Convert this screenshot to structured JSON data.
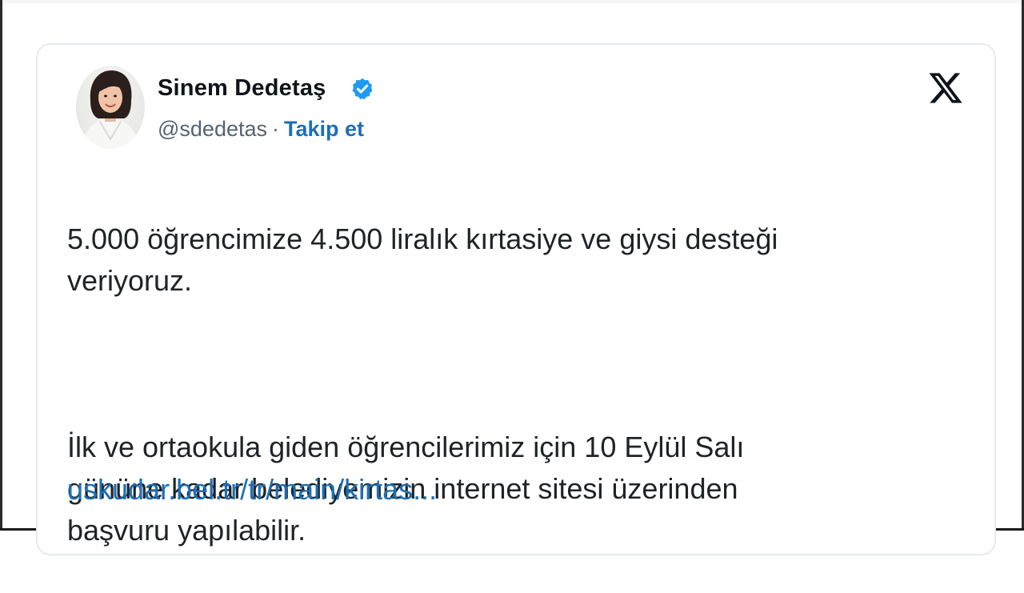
{
  "tweet": {
    "author": {
      "display_name": "Sinem Dedetaş",
      "handle": "@sdedetas",
      "separator": "·",
      "follow_label": "Takip et",
      "verified": true,
      "verified_icon": "verified-badge-icon",
      "avatar": "author-photo"
    },
    "platform_icon": "x-logo-icon",
    "paragraphs": [
      "5.000 öğrencimize 4.500 liralık kırtasiye ve giysi desteği\nveriyoruz.",
      "İlk ve ortaokula giden öğrencilerimiz için 10 Eylül Salı\ngününe kadar belediyemizin internet sitesi üzerinden\nbaşvuru yapılabilir."
    ],
    "link_text": "uskudar.bel.tr/tr/main/kirtas..."
  },
  "colors": {
    "text": "#1f2326",
    "name": "#0f1419",
    "handle": "#536471",
    "link": "#1d6fb8",
    "verified": "#1d9bf0",
    "card_border": "#e7eaed"
  }
}
